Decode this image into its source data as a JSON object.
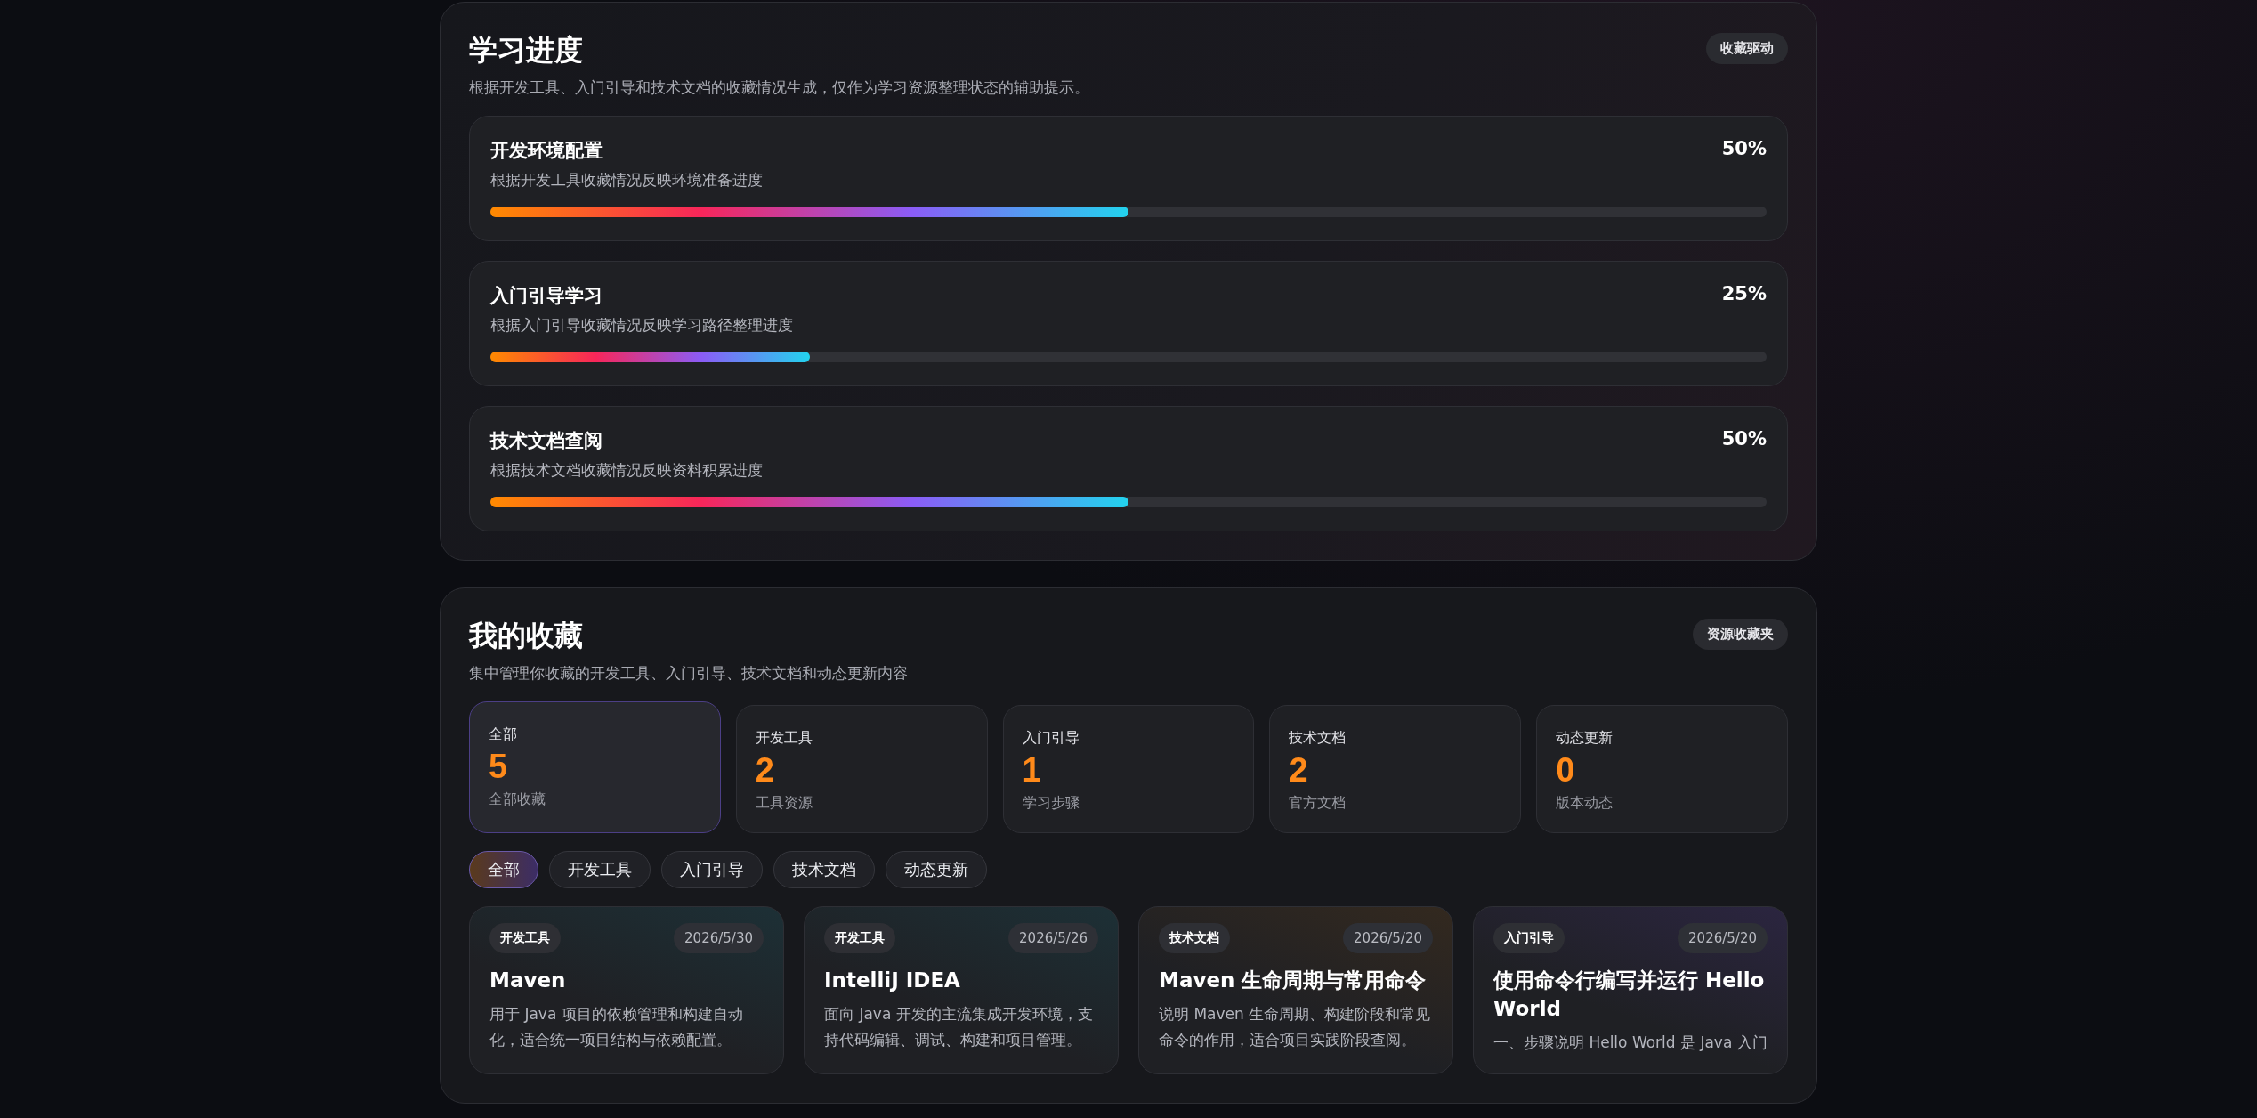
{
  "progress_panel": {
    "title": "学习进度",
    "badge": "收藏驱动",
    "subtitle": "根据开发工具、入门引导和技术文档的收藏情况生成，仅作为学习资源整理状态的辅助提示。",
    "items": [
      {
        "title": "开发环境配置",
        "percent": "50%",
        "description": "根据开发工具收藏情况反映环境准备进度",
        "level": 0.5
      },
      {
        "title": "入门引导学习",
        "percent": "25%",
        "description": "根据入门引导收藏情况反映学习路径整理进度",
        "level": 0.25
      },
      {
        "title": "技术文档查阅",
        "percent": "50%",
        "description": "根据技术文档收藏情况反映资料积累进度",
        "level": 0.5
      }
    ]
  },
  "favorites_panel": {
    "title": "我的收藏",
    "badge": "资源收藏夹",
    "subtitle": "集中管理你收藏的开发工具、入门引导、技术文档和动态更新内容",
    "stats": [
      {
        "label": "全部",
        "count": "5",
        "caption": "全部收藏",
        "selected": true
      },
      {
        "label": "开发工具",
        "count": "2",
        "caption": "工具资源",
        "selected": false
      },
      {
        "label": "入门引导",
        "count": "1",
        "caption": "学习步骤",
        "selected": false
      },
      {
        "label": "技术文档",
        "count": "2",
        "caption": "官方文档",
        "selected": false
      },
      {
        "label": "动态更新",
        "count": "0",
        "caption": "版本动态",
        "selected": false
      }
    ],
    "filters": [
      {
        "label": "全部",
        "selected": true
      },
      {
        "label": "开发工具",
        "selected": false
      },
      {
        "label": "入门引导",
        "selected": false
      },
      {
        "label": "技术文档",
        "selected": false
      },
      {
        "label": "动态更新",
        "selected": false
      }
    ],
    "cards": [
      {
        "kind": "tool",
        "tag": "开发工具",
        "date": "2026/5/30",
        "title": "Maven",
        "description": "用于 Java 项目的依赖管理和构建自动化，适合统一项目结构与依赖配置。"
      },
      {
        "kind": "tool",
        "tag": "开发工具",
        "date": "2026/5/26",
        "title": "IntelliJ IDEA",
        "description": "面向 Java 开发的主流集成开发环境，支持代码编辑、调试、构建和项目管理。"
      },
      {
        "kind": "doc",
        "tag": "技术文档",
        "date": "2026/5/20",
        "title": "Maven 生命周期与常用命令",
        "description": "说明 Maven 生命周期、构建阶段和常见命令的作用，适合项目实践阶段查阅。"
      },
      {
        "kind": "guide",
        "tag": "入门引导",
        "date": "2026/5/20",
        "title": "使用命令行编写并运行 Hello World",
        "description": "一、步骤说明 Hello World 是 Java 入门"
      }
    ]
  }
}
